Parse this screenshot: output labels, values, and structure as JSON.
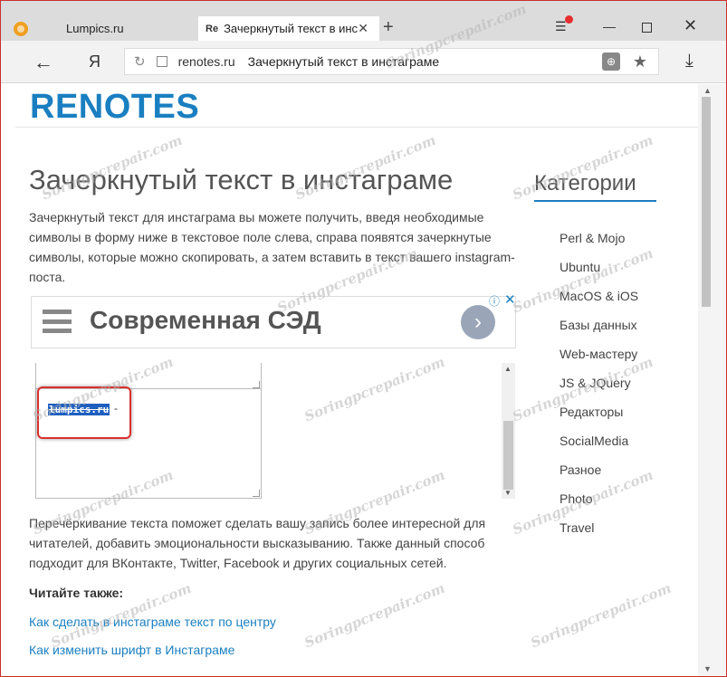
{
  "browser": {
    "tabs": [
      {
        "label": "Lumpics.ru"
      },
      {
        "favicon_text": "Re",
        "label": "Зачеркнутый текст в инс"
      }
    ],
    "close_tab_glyph": "✕",
    "new_tab_glyph": "+",
    "yandex_glyph": "Я",
    "address": {
      "domain": "renotes.ru",
      "page_title": "Зачеркнутый текст в инстаграме"
    }
  },
  "site": {
    "logo": "RENOTES"
  },
  "article": {
    "title": "Зачеркнутый текст в инстаграме",
    "intro": "Зачеркнутый текст для инстаграма вы можете получить, введя необходимые символы в форму ниже в текстовое поле слева, справа появятся зачеркнутые символы, которые можно скопировать, а затем вставить в текст вашего instagram-поста.",
    "ad_text": "Современная СЭД",
    "output_selected": "lumpics.ru",
    "output_suffix": "-",
    "para2": "Перечёркивание текста поможет сделать вашу запись более интересной для читателей, добавить эмоциональности высказыванию. Также данный способ подходит для ВКонтакте, Twitter, Facebook и других социальных сетей.",
    "read_also": "Читайте также:",
    "link1": "Как сделать в инстаграме текст по центру",
    "link2": "Как изменить шрифт в Инстаграме"
  },
  "sidebar": {
    "title": "Категории",
    "categories": [
      "Perl & Mojo",
      "Ubuntu",
      "MacOS & iOS",
      "Базы данных",
      "Web-мастеру",
      "JS & JQuery",
      "Редакторы",
      "SocialMedia",
      "Разное",
      "Photo",
      "Travel"
    ]
  },
  "watermark": "Soringpcrepair.com",
  "colors": {
    "accent": "#1a7fc1",
    "highlight_border": "#d9302c",
    "selection": "#1e5fbf"
  }
}
